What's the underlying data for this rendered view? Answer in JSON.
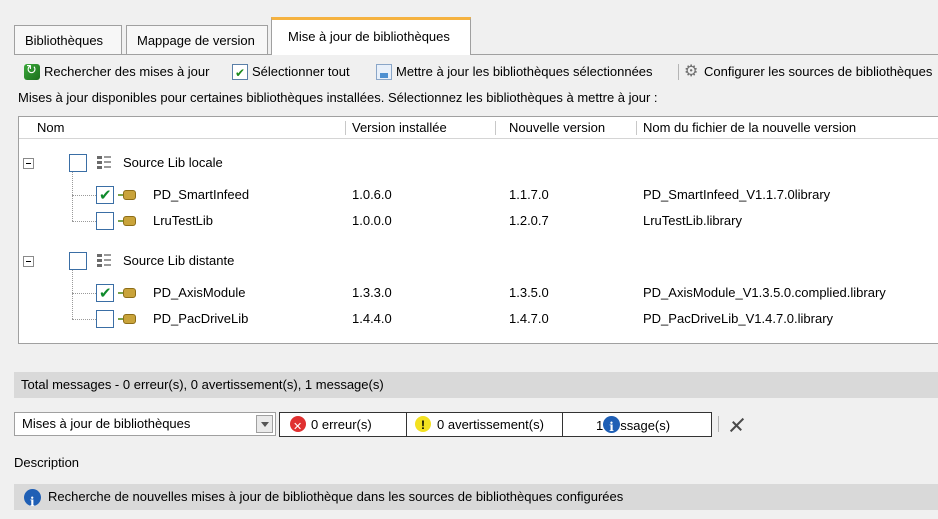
{
  "tabs": [
    {
      "label": "Bibliothèques",
      "active": false
    },
    {
      "label": "Mappage de version",
      "active": false
    },
    {
      "label": "Mise à jour de bibliothèques",
      "active": true
    }
  ],
  "toolbar": {
    "search_updates": "Rechercher des mises à jour",
    "select_all": "Sélectionner tout",
    "update_selected": "Mettre à jour les bibliothèques sélectionnées",
    "configure_sources": "Configurer les sources de bibliothèques"
  },
  "info_text": "Mises à jour disponibles pour certaines bibliothèques installées. Sélectionnez les bibliothèques à mettre à jour :",
  "grid": {
    "columns": [
      "Nom",
      "Version installée",
      "Nouvelle version",
      "Nom du fichier de la nouvelle version"
    ],
    "groups": [
      {
        "name": "Source Lib locale",
        "checked": false,
        "items": [
          {
            "name": "PD_SmartInfeed",
            "installed": "1.0.6.0",
            "new": "1.1.7.0",
            "file": "PD_SmartInfeed_V1.1.7.0library",
            "checked": true
          },
          {
            "name": "LruTestLib",
            "installed": "1.0.0.0",
            "new": "1.2.0.7",
            "file": "LruTestLib.library",
            "checked": false
          }
        ]
      },
      {
        "name": "Source Lib distante",
        "checked": false,
        "items": [
          {
            "name": "PD_AxisModule",
            "installed": "1.3.3.0",
            "new": "1.3.5.0",
            "file": "PD_AxisModule_V1.3.5.0.complied.library",
            "checked": true
          },
          {
            "name": "PD_PacDriveLib",
            "installed": "1.4.4.0",
            "new": "1.4.7.0",
            "file": "PD_PacDriveLib_V1.4.7.0.library",
            "checked": false
          }
        ]
      }
    ]
  },
  "messages": {
    "total": "Total messages - 0 erreur(s), 0 avertissement(s), 1 message(s)",
    "category": "Mises à jour de bibliothèques",
    "errors": "0 erreur(s)",
    "warnings": "0 avertissement(s)",
    "info_count": "1",
    "info_label": "ssage(s)"
  },
  "description": {
    "header": "Description",
    "text": "Recherche de nouvelles mises à jour de bibliothèque dans les sources de bibliothèques configurées"
  },
  "colors": {
    "active_tab_accent": "#f5b240",
    "checkmark": "#0f8a2c",
    "error": "#e03030",
    "warning": "#f3e120",
    "info": "#1f5fb5"
  }
}
